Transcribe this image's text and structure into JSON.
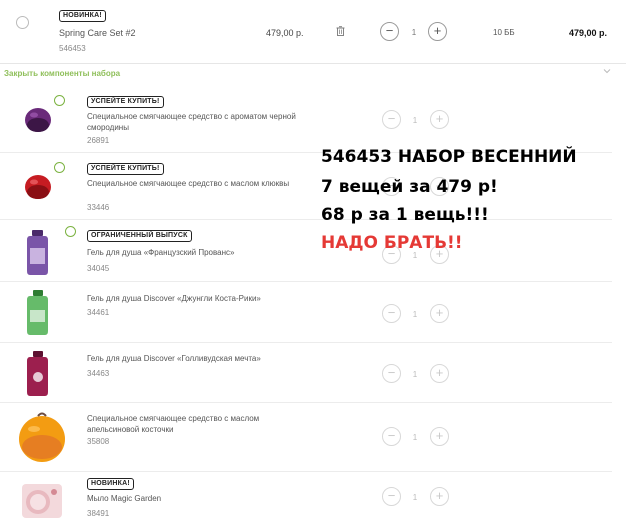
{
  "set": {
    "badge": "НОВИНКА!",
    "name": "Spring Care Set #2",
    "code": "546453",
    "price": "479,00 р.",
    "quantity": "1",
    "points": "10 ББ",
    "total": "479,00 р."
  },
  "collapse_label": "Закрыть компоненты набора",
  "items": [
    {
      "badge": "УСПЕЙТЕ КУПИТЬ!",
      "name": "Специальное смягчающее средство с ароматом черной смородины",
      "code": "26891",
      "quantity": "1"
    },
    {
      "badge": "УСПЕЙТЕ КУПИТЬ!",
      "name": "Специальное смягчающее средство с маслом клюквы",
      "code": "33446",
      "quantity": "1"
    },
    {
      "badge": "ОГРАНИЧЕННЫЙ ВЫПУСК",
      "name": "Гель для душа «Французский Прованс»",
      "code": "34045",
      "quantity": "1"
    },
    {
      "name": "Гель для душа Discover «Джунгли Коста-Рики»",
      "code": "34461",
      "quantity": "1"
    },
    {
      "name": "Гель для душа Discover «Голливудская мечта»",
      "code": "34463",
      "quantity": "1"
    },
    {
      "name": "Специальное смягчающее средство с маслом апельсиновой косточки",
      "code": "35808",
      "quantity": "1"
    },
    {
      "badge": "НОВИНКА!",
      "name": "Мыло Magic Garden",
      "code": "38491",
      "quantity": "1"
    }
  ],
  "overlay": {
    "line1": "546453 НАБОР ВЕСЕННИЙ",
    "line2": "7 вещей за 479 р!",
    "line3": "68 р за 1 вещь!!!",
    "line4": "НАДО БРАТЬ!!"
  },
  "colors": {
    "accent_green": "#8fbf5a",
    "overlay_red": "#e53935"
  },
  "icons": {
    "trash": "trash-icon",
    "chevron": "chevron-down-icon",
    "leaf": "leaf-icon"
  }
}
